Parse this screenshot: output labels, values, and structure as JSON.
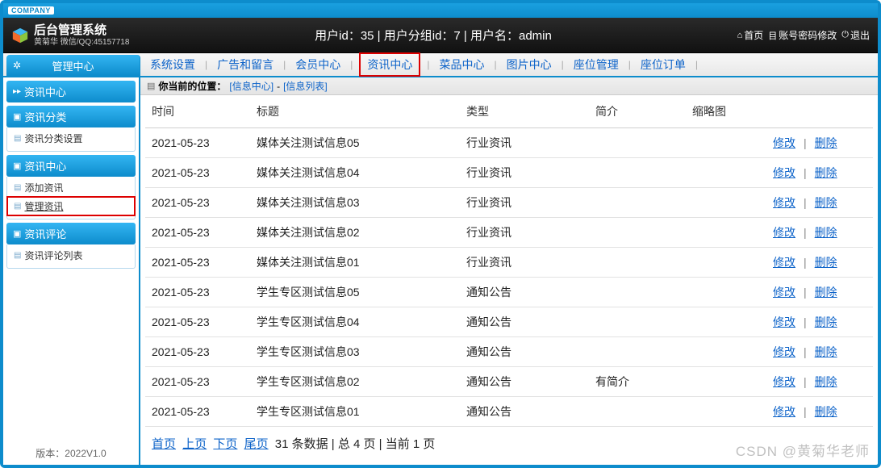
{
  "brand": {
    "company": "COMPANY",
    "title": "后台管理系统",
    "subtitle": "黄菊华 微信/QQ:45157718"
  },
  "header": {
    "user_info": "用户id：35 | 用户分组id：7 | 用户名：admin",
    "home": "首页",
    "pwd": "账号密码修改",
    "logout": "退出"
  },
  "sidebar_header": "管理中心",
  "topnav": {
    "items": [
      "系统设置",
      "广告和留言",
      "会员中心",
      "资讯中心",
      "菜品中心",
      "图片中心",
      "座位管理",
      "座位订单"
    ],
    "highlight_index": 3
  },
  "sidebar": {
    "top_title": "资讯中心",
    "groups": [
      {
        "title": "资讯分类",
        "items": [
          {
            "label": "资讯分类设置",
            "active": false
          }
        ]
      },
      {
        "title": "资讯中心",
        "items": [
          {
            "label": "添加资讯",
            "active": false
          },
          {
            "label": "管理资讯",
            "active": true
          }
        ]
      },
      {
        "title": "资讯评论",
        "items": [
          {
            "label": "资讯评论列表",
            "active": false
          }
        ]
      }
    ],
    "version": "版本：2022V1.0"
  },
  "crumb": {
    "prefix": "你当前的位置：",
    "a": "[信息中心]",
    "sep": "-",
    "b": "[信息列表]"
  },
  "table": {
    "columns": [
      "时间",
      "标题",
      "类型",
      "简介",
      "缩略图",
      ""
    ],
    "edit": "修改",
    "del": "删除",
    "rows": [
      {
        "time": "2021-05-23",
        "title": "媒体关注测试信息05",
        "type": "行业资讯",
        "intro": ""
      },
      {
        "time": "2021-05-23",
        "title": "媒体关注测试信息04",
        "type": "行业资讯",
        "intro": ""
      },
      {
        "time": "2021-05-23",
        "title": "媒体关注测试信息03",
        "type": "行业资讯",
        "intro": ""
      },
      {
        "time": "2021-05-23",
        "title": "媒体关注测试信息02",
        "type": "行业资讯",
        "intro": ""
      },
      {
        "time": "2021-05-23",
        "title": "媒体关注测试信息01",
        "type": "行业资讯",
        "intro": ""
      },
      {
        "time": "2021-05-23",
        "title": "学生专区测试信息05",
        "type": "通知公告",
        "intro": ""
      },
      {
        "time": "2021-05-23",
        "title": "学生专区测试信息04",
        "type": "通知公告",
        "intro": ""
      },
      {
        "time": "2021-05-23",
        "title": "学生专区测试信息03",
        "type": "通知公告",
        "intro": ""
      },
      {
        "time": "2021-05-23",
        "title": "学生专区测试信息02",
        "type": "通知公告",
        "intro": "有简介"
      },
      {
        "time": "2021-05-23",
        "title": "学生专区测试信息01",
        "type": "通知公告",
        "intro": ""
      }
    ]
  },
  "pager": {
    "first": "首页",
    "prev": "上页",
    "next": "下页",
    "last": "尾页",
    "info": "31 条数据 | 总 4 页 | 当前 1 页"
  },
  "watermark": "CSDN @黄菊华老师"
}
